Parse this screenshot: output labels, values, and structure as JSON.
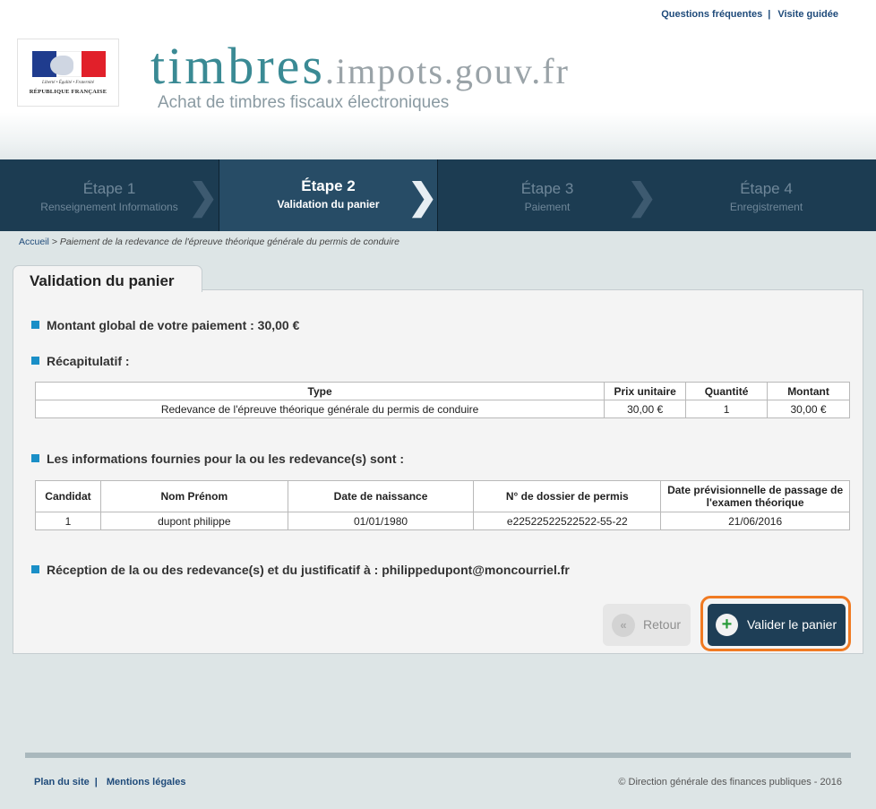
{
  "top_links": {
    "faq": "Questions fréquentes",
    "separator": "|",
    "tour": "Visite guidée"
  },
  "logo": {
    "motto": "Liberté • Égalité • Fraternité",
    "republic": "RÉPUBLIQUE FRANÇAISE"
  },
  "site": {
    "title_main": "timbres",
    "title_domain": ".impots.gouv.fr",
    "subtitle": "Achat de timbres fiscaux électroniques"
  },
  "steps": [
    {
      "title": "Étape 1",
      "subtitle": "Renseignement Informations"
    },
    {
      "title": "Étape 2",
      "subtitle": "Validation du panier"
    },
    {
      "title": "Étape 3",
      "subtitle": "Paiement"
    },
    {
      "title": "Étape 4",
      "subtitle": "Enregistrement"
    }
  ],
  "breadcrumb": {
    "home": "Accueil",
    "rest": " > Paiement de la redevance de l'épreuve théorique générale du permis de conduire"
  },
  "panel": {
    "tab_title": "Validation du panier",
    "total": "Montant global de votre paiement : 30,00 €",
    "recap_title": "Récapitulatif :",
    "recap_headers": [
      "Type",
      "Prix unitaire",
      "Quantité",
      "Montant"
    ],
    "recap_row": [
      "Redevance de l'épreuve théorique générale du permis de conduire",
      "30,00 €",
      "1",
      "30,00 €"
    ],
    "info_title": "Les informations fournies pour la ou les redevance(s) sont :",
    "info_headers": [
      "Candidat",
      "Nom Prénom",
      "Date de naissance",
      "N° de dossier de permis",
      "Date prévisionnelle de passage de l'examen théorique"
    ],
    "info_row": [
      "1",
      "dupont philippe",
      "01/01/1980",
      "e22522522522522-55-22",
      "21/06/2016"
    ],
    "reception": "Réception de la ou des redevance(s) et du justificatif à : philippedupont@moncourriel.fr",
    "btn_back": "Retour",
    "btn_back_icon": "«",
    "btn_validate": "Valider le panier",
    "btn_validate_icon": "+"
  },
  "footer": {
    "sitemap": "Plan du site",
    "separator": "|",
    "legal": "Mentions légales",
    "copyright": "© Direction générale des finances publiques - 2016"
  }
}
